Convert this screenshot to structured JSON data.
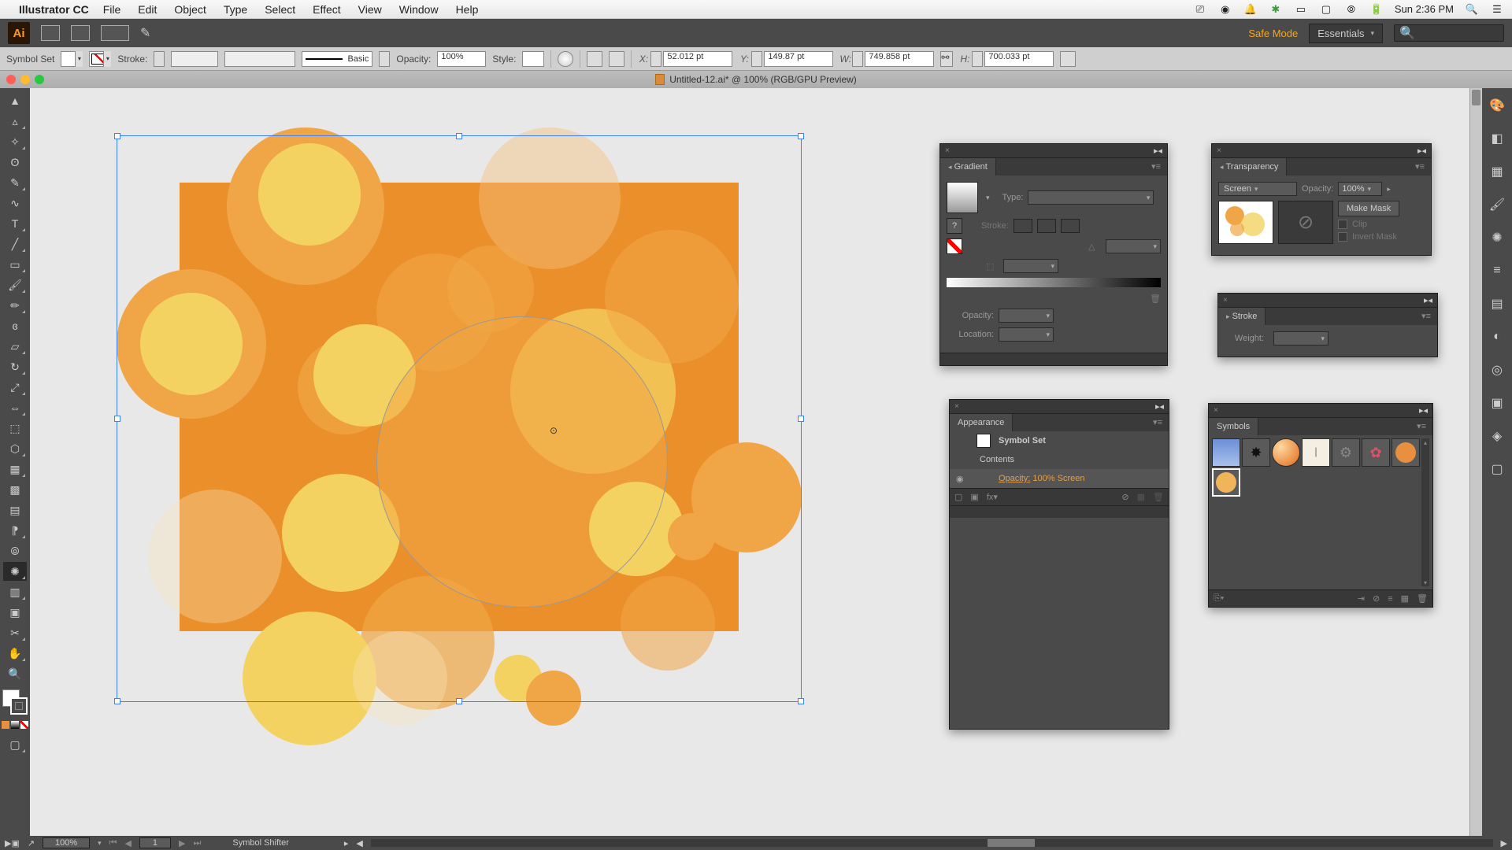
{
  "menubar": {
    "app": "Illustrator CC",
    "menus": [
      "File",
      "Edit",
      "Object",
      "Type",
      "Select",
      "Effect",
      "View",
      "Window",
      "Help"
    ],
    "datetime": "Sun 2:36 PM"
  },
  "appbar": {
    "safe_mode": "Safe Mode",
    "workspace": "Essentials"
  },
  "controlbar": {
    "selection_type": "Symbol Set",
    "stroke_label": "Stroke:",
    "stroke_style": "Basic",
    "opacity_label": "Opacity:",
    "opacity_value": "100%",
    "style_label": "Style:",
    "x_label": "X:",
    "x_value": "52.012 pt",
    "y_label": "Y:",
    "y_value": "149.87 pt",
    "w_label": "W:",
    "w_value": "749.858 pt",
    "h_label": "H:",
    "h_value": "700.033 pt"
  },
  "doctab": {
    "title": "Untitled-12.ai* @ 100% (RGB/GPU Preview)"
  },
  "panels": {
    "gradient": {
      "title": "Gradient",
      "type_label": "Type:",
      "stroke_label": "Stroke:",
      "opacity_label": "Opacity:",
      "location_label": "Location:"
    },
    "transparency": {
      "title": "Transparency",
      "mode": "Screen",
      "opacity_label": "Opacity:",
      "opacity_value": "100%",
      "make_mask": "Make Mask",
      "clip": "Clip",
      "invert": "Invert Mask"
    },
    "stroke": {
      "title": "Stroke",
      "weight_label": "Weight:"
    },
    "appearance": {
      "title": "Appearance",
      "obj": "Symbol Set",
      "contents": "Contents",
      "opacity_label": "Opacity:",
      "opacity_value": "100% Screen"
    },
    "symbols": {
      "title": "Symbols"
    }
  },
  "statusbar": {
    "zoom": "100%",
    "page": "1",
    "tool": "Symbol Shifter"
  }
}
